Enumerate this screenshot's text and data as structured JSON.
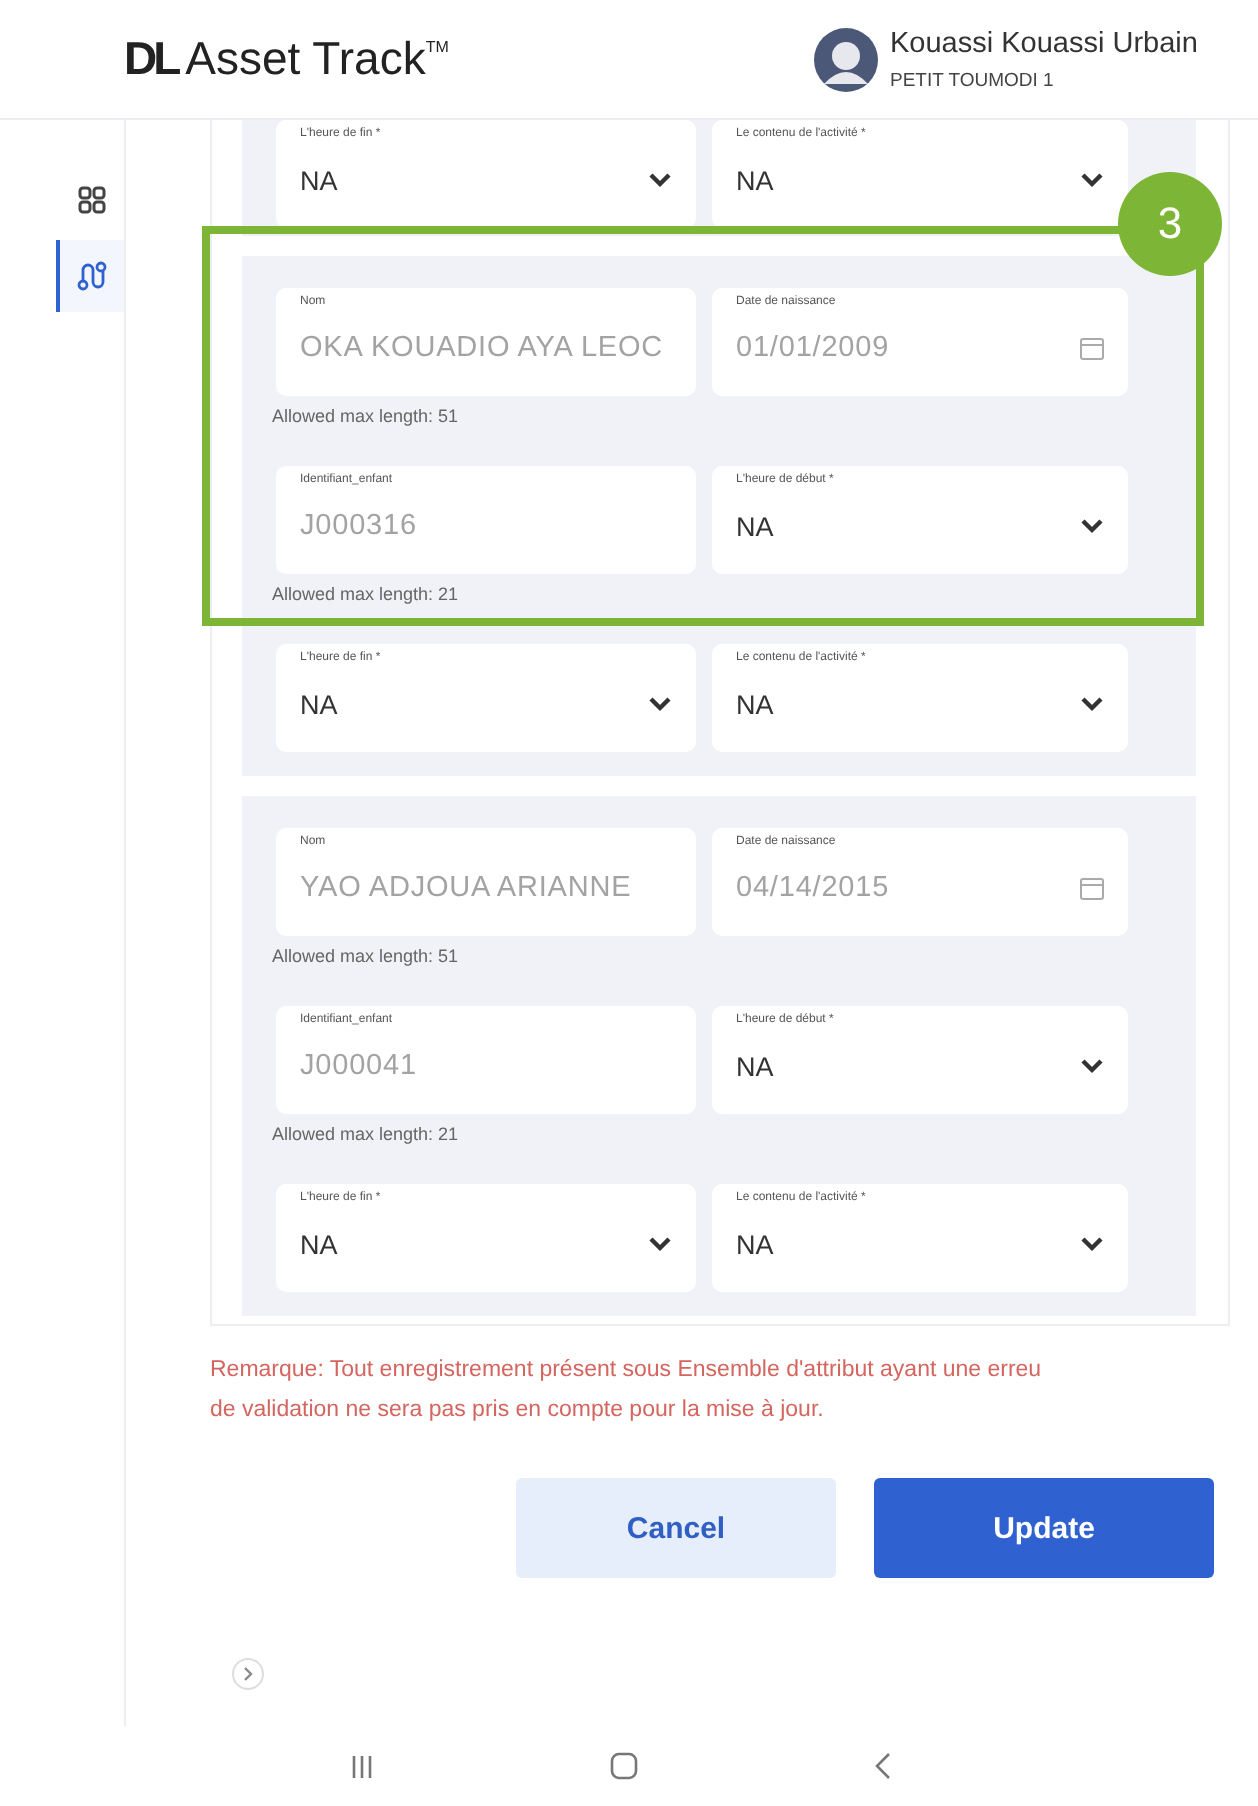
{
  "header": {
    "logo_mark": "DL",
    "logo_text": "Asset Track",
    "logo_sup": "TM",
    "user_name": "Kouassi Kouassi Urbain",
    "user_site": "PETIT TOUMODI 1"
  },
  "sidebar": {
    "items": [
      {
        "selected": false
      },
      {
        "selected": true
      }
    ]
  },
  "records": [
    {
      "fields": [
        {
          "kind": "select",
          "label": "L'heure de fin *",
          "value": "NA",
          "disabled": false
        },
        {
          "kind": "select",
          "label": "Le contenu de l'activité *",
          "value": "NA",
          "disabled": false
        }
      ]
    },
    {
      "fields": [
        {
          "kind": "text",
          "label": "Nom",
          "value": "OKA KOUADIO AYA LEOC",
          "disabled": true,
          "hint": "Allowed max length: 51"
        },
        {
          "kind": "date",
          "label": "Date de naissance",
          "value": "01/01/2009",
          "disabled": true
        },
        {
          "kind": "text",
          "label": "Identifiant_enfant",
          "value": "J000316",
          "disabled": true,
          "hint": "Allowed max length: 21"
        },
        {
          "kind": "select",
          "label": "L'heure de début *",
          "value": "NA",
          "disabled": false
        },
        {
          "kind": "select",
          "label": "L'heure de fin *",
          "value": "NA",
          "disabled": false
        },
        {
          "kind": "select",
          "label": "Le contenu de l'activité *",
          "value": "NA",
          "disabled": false
        }
      ]
    },
    {
      "fields": [
        {
          "kind": "text",
          "label": "Nom",
          "value": "YAO ADJOUA ARIANNE",
          "disabled": true,
          "hint": "Allowed max length: 51"
        },
        {
          "kind": "date",
          "label": "Date de naissance",
          "value": "04/14/2015",
          "disabled": true
        },
        {
          "kind": "text",
          "label": "Identifiant_enfant",
          "value": "J000041",
          "disabled": true,
          "hint": "Allowed max length: 21"
        },
        {
          "kind": "select",
          "label": "L'heure de début *",
          "value": "NA",
          "disabled": false
        },
        {
          "kind": "select",
          "label": "L'heure de fin *",
          "value": "NA",
          "disabled": false
        },
        {
          "kind": "select",
          "label": "Le contenu de l'activité *",
          "value": "NA",
          "disabled": false
        }
      ]
    }
  ],
  "note_lines": [
    "Remarque: Tout enregistrement présent sous Ensemble d'attribut ayant une erreu",
    "de validation ne sera pas pris en compte pour la mise à jour."
  ],
  "buttons": [
    {
      "kind": "secondary",
      "label": "Cancel"
    },
    {
      "kind": "primary",
      "label": "Update"
    }
  ],
  "annotation": {
    "label": "3"
  }
}
